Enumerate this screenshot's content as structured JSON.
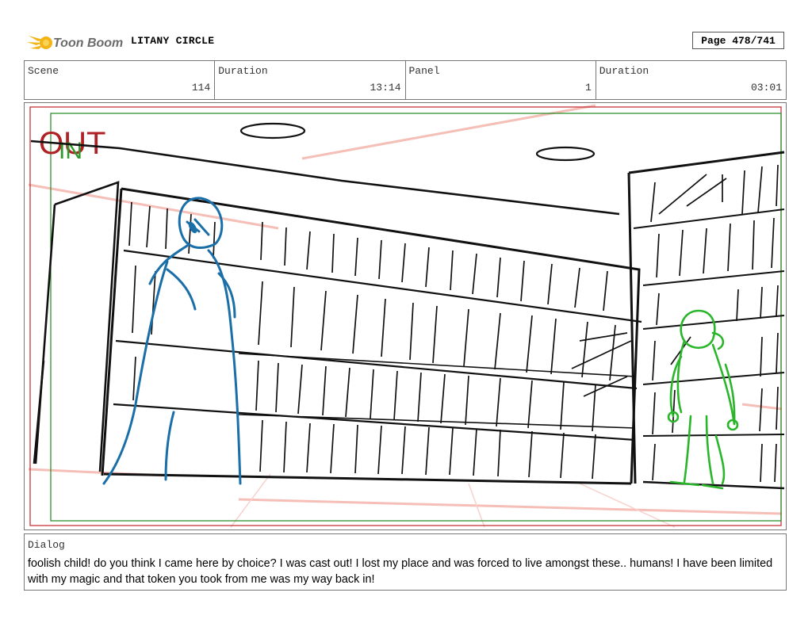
{
  "header": {
    "logo_text": "Toon Boom",
    "project_title": "LITANY CIRCLE",
    "page_label": "Page 478/741"
  },
  "info": {
    "scene_label": "Scene",
    "scene_value": "114",
    "scene_duration_label": "Duration",
    "scene_duration_value": "13:14",
    "panel_label": "Panel",
    "panel_value": "1",
    "panel_duration_label": "Duration",
    "panel_duration_value": "03:01"
  },
  "panel": {
    "out_label": "OUT",
    "in_label": "IN",
    "colors": {
      "out_frame": "#c0262c",
      "in_frame": "#1f8a1f",
      "blue_figure": "#1a6fa8",
      "green_figure": "#2bb52b",
      "pink_guides": "#f4b8b0"
    }
  },
  "dialog": {
    "label": "Dialog",
    "text": "foolish child! do you think I came here by choice? I was cast out! I lost my place and was forced to live amongst these.. humans! I have been limited with my magic and that token you took from me was my way back in!"
  }
}
